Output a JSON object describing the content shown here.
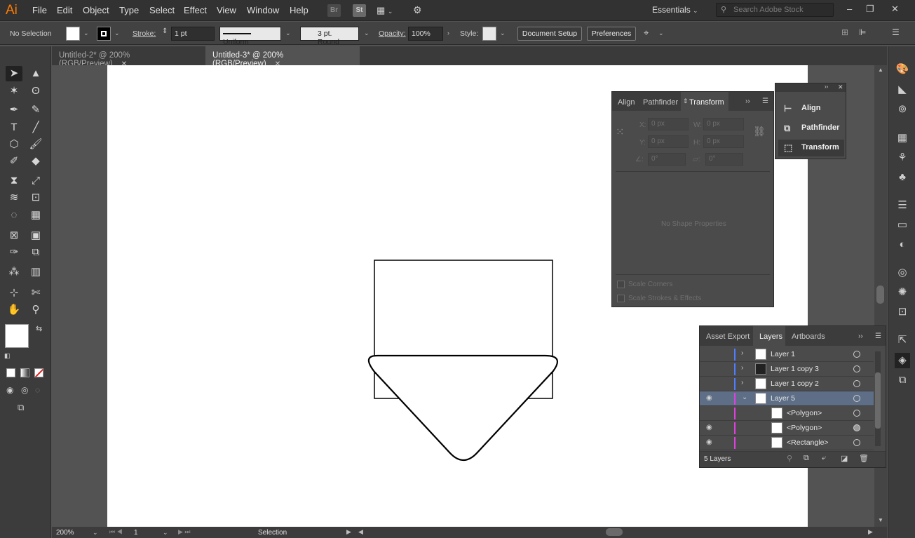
{
  "app": {
    "logo": "Ai",
    "menu": [
      "File",
      "Edit",
      "Object",
      "Type",
      "Select",
      "Effect",
      "View",
      "Window",
      "Help"
    ],
    "bridge_labels": [
      "Br",
      "St"
    ],
    "workspace": "Essentials",
    "search_placeholder": "Search Adobe Stock"
  },
  "control_bar": {
    "selection": "No Selection",
    "stroke_label": "Stroke:",
    "stroke_weight": "1 pt",
    "stroke_profile": "Uniform",
    "brush": "3 pt. Round",
    "opacity_label": "Opacity:",
    "opacity": "100%",
    "style_label": "Style:",
    "document_setup": "Document Setup",
    "preferences": "Preferences"
  },
  "tabs": [
    {
      "label": "Untitled-2* @ 200% (RGB/Preview)",
      "active": false
    },
    {
      "label": "Untitled-3* @ 200% (RGB/Preview)",
      "active": true
    }
  ],
  "transform_panel": {
    "tabs": [
      "Align",
      "Pathfinder",
      "Transform"
    ],
    "x_label": "X:",
    "x_value": "0 px",
    "y_label": "Y:",
    "y_value": "0 px",
    "w_label": "W:",
    "w_value": "0 px",
    "h_label": "H:",
    "h_value": "0 px",
    "angle": "0°",
    "shear": "0°",
    "no_shape": "No Shape Properties",
    "scale_corners": "Scale Corners",
    "scale_strokes": "Scale Strokes & Effects"
  },
  "flyout": {
    "items": [
      "Align",
      "Pathfinder",
      "Transform"
    ]
  },
  "layers_panel": {
    "tabs": [
      "Asset Export",
      "Layers",
      "Artboards"
    ],
    "rows": [
      {
        "name": "Layer 1",
        "color": "#4f7fff"
      },
      {
        "name": "Layer 1 copy 3",
        "color": "#4f7fff"
      },
      {
        "name": "Layer 1 copy 2",
        "color": "#4f7fff"
      },
      {
        "name": "Layer 5",
        "color": "#e040e0"
      },
      {
        "name": "<Polygon>",
        "color": "#e040e0"
      },
      {
        "name": "<Polygon>",
        "color": "#e040e0"
      },
      {
        "name": "<Rectangle>",
        "color": "#e040e0"
      }
    ],
    "count": "5 Layers"
  },
  "status_bar": {
    "zoom": "200%",
    "page": "1",
    "tool": "Selection"
  }
}
